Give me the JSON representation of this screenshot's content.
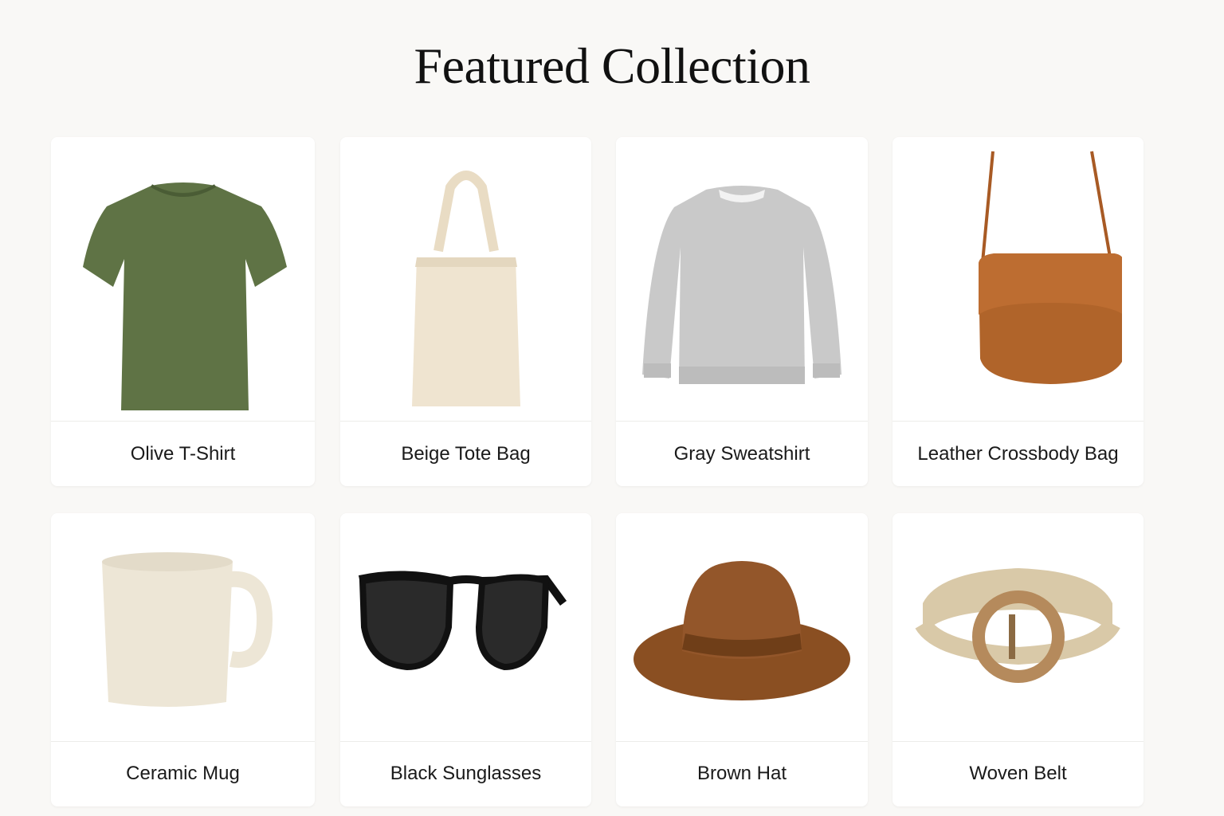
{
  "page": {
    "title": "Featured Collection"
  },
  "products": [
    {
      "name": "Olive T-Shirt",
      "icon": "olive-tshirt-image",
      "color": "#5f7345"
    },
    {
      "name": "Beige Tote Bag",
      "icon": "beige-tote-bag-image",
      "color": "#efe4d0"
    },
    {
      "name": "Gray Sweatshirt",
      "icon": "gray-sweatshirt-image",
      "color": "#c9c9c9"
    },
    {
      "name": "Leather Crossbody Bag",
      "icon": "leather-crossbody-bag-image",
      "color": "#b0642a"
    },
    {
      "name": "Ceramic Mug",
      "icon": "ceramic-mug-image",
      "color": "#ede6d6"
    },
    {
      "name": "Black Sunglasses",
      "icon": "black-sunglasses-image",
      "color": "#111111"
    },
    {
      "name": "Brown Hat",
      "icon": "brown-hat-image",
      "color": "#8a4f22"
    },
    {
      "name": "Woven Belt",
      "icon": "woven-belt-image",
      "color": "#d9c9a8"
    }
  ]
}
